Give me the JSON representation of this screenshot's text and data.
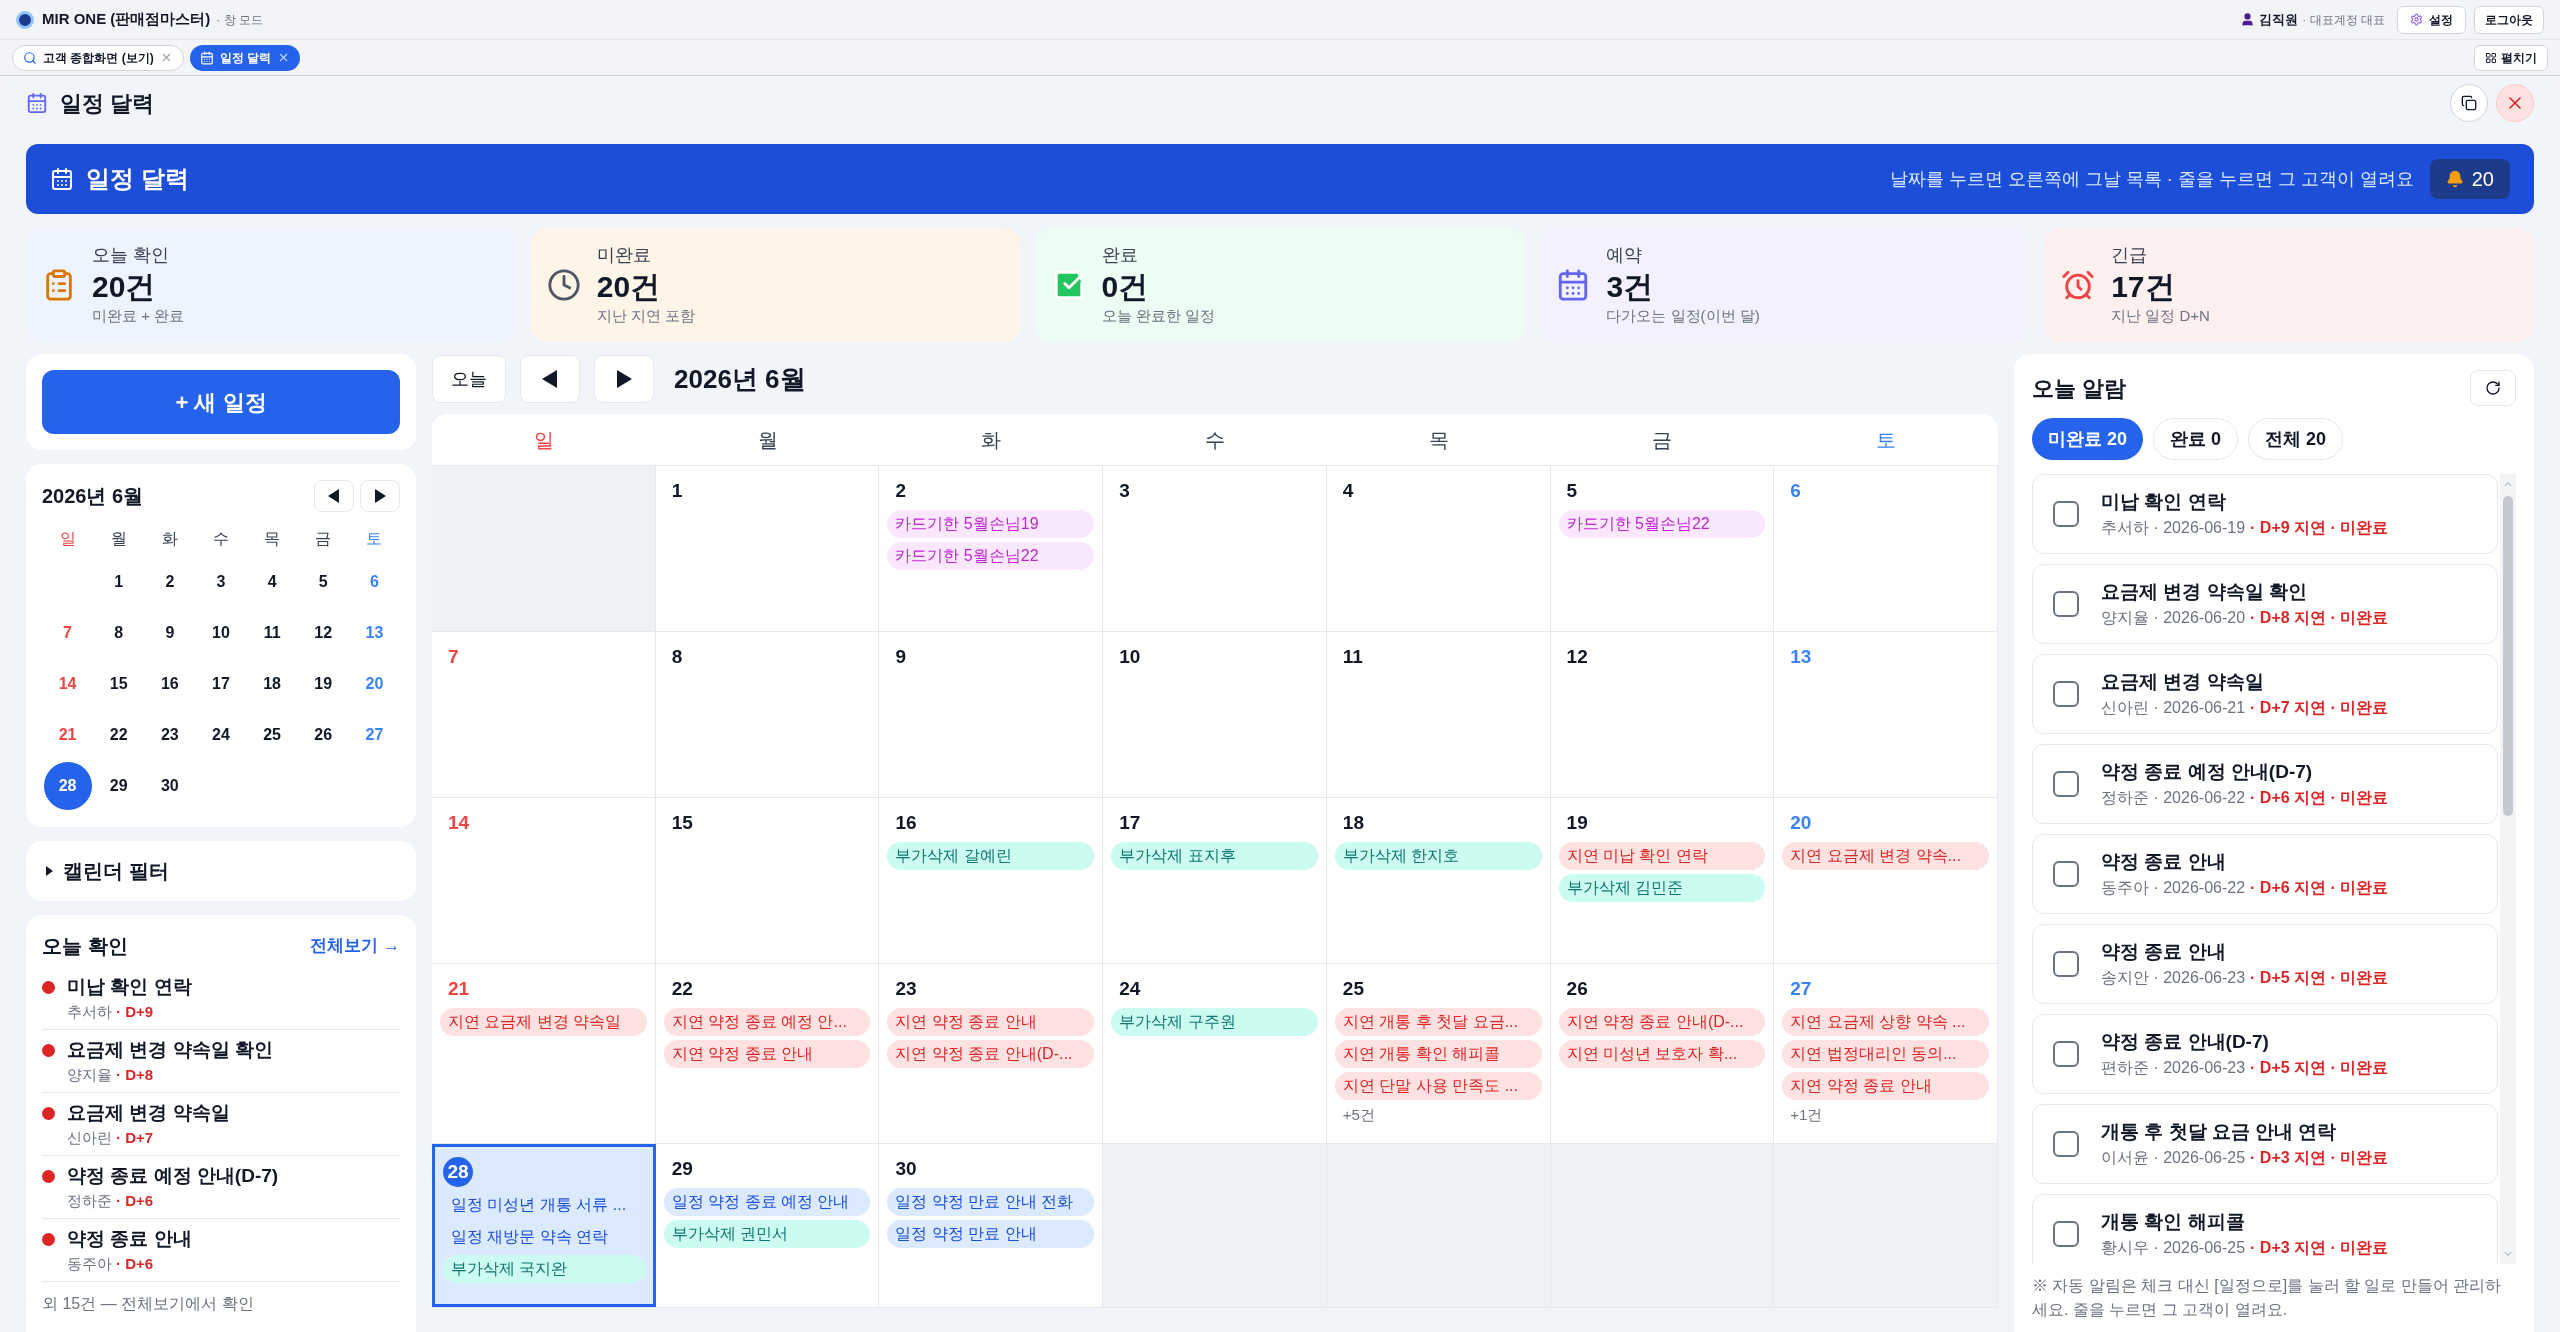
{
  "app_bar": {
    "title": "MIR ONE (판매점마스터)",
    "mode": "· 창 모드",
    "user": "김직원",
    "role": "· 대표계정 대표",
    "settings": "설정",
    "logout": "로그아웃"
  },
  "tabs": [
    {
      "label": "고객 종합화면 (보기)",
      "kind": "search",
      "selected": false
    },
    {
      "label": "일정 달력",
      "kind": "calendar",
      "selected": true
    }
  ],
  "expand_button": "펼치기",
  "window": {
    "title": "일정 달력"
  },
  "banner": {
    "title": "일정 달력",
    "hint": "날짜를 누르면 오른쪽에 그날 목록 · 줄을 누르면 그 고객이 열려요",
    "badge": "20"
  },
  "stats": [
    {
      "kind": "clipboard",
      "label": "오늘 확인",
      "value": "20건",
      "sub": "미완료 + 완료"
    },
    {
      "kind": "clock",
      "label": "미완료",
      "value": "20건",
      "sub": "지난 지연 포함"
    },
    {
      "kind": "check",
      "label": "완료",
      "value": "0건",
      "sub": "오늘 완료한 일정"
    },
    {
      "kind": "calendar",
      "label": "예약",
      "value": "3건",
      "sub": "다가오는 일정(이번 달)"
    },
    {
      "kind": "alarm",
      "label": "긴급",
      "value": "17건",
      "sub": "지난 일정 D+N"
    }
  ],
  "new_event_button": "+ 새 일정",
  "mini_calendar": {
    "title": "2026년 6월",
    "weekdays": [
      "일",
      "월",
      "화",
      "수",
      "목",
      "금",
      "토"
    ],
    "weeks": [
      [
        {
          "day": "1",
          "selected": false
        },
        {
          "day": "2",
          "selected": false
        },
        {
          "day": "3",
          "selected": false
        },
        {
          "day": "4",
          "selected": false
        },
        {
          "day": "5",
          "selected": false
        },
        {
          "day": "6",
          "selected": false
        }
      ],
      [
        {
          "day": "7",
          "selected": false
        },
        {
          "day": "8",
          "selected": false
        },
        {
          "day": "9",
          "selected": false
        },
        {
          "day": "10",
          "selected": false
        },
        {
          "day": "11",
          "selected": false
        },
        {
          "day": "12",
          "selected": false
        },
        {
          "day": "13",
          "selected": false
        }
      ],
      [
        {
          "day": "14",
          "selected": false
        },
        {
          "day": "15",
          "selected": false
        },
        {
          "day": "16",
          "selected": false
        },
        {
          "day": "17",
          "selected": false
        },
        {
          "day": "18",
          "selected": false
        },
        {
          "day": "19",
          "selected": false
        },
        {
          "day": "20",
          "selected": false
        }
      ],
      [
        {
          "day": "21",
          "selected": false
        },
        {
          "day": "22",
          "selected": false
        },
        {
          "day": "23",
          "selected": false
        },
        {
          "day": "24",
          "selected": false
        },
        {
          "day": "25",
          "selected": false
        },
        {
          "day": "26",
          "selected": false
        },
        {
          "day": "27",
          "selected": false
        }
      ],
      [
        {
          "day": "28",
          "selected": true
        },
        {
          "day": "29",
          "selected": false
        },
        {
          "day": "30",
          "selected": false
        }
      ]
    ]
  },
  "filter": {
    "label": "캘린더 필터",
    "expanded": false
  },
  "today_check": {
    "title": "오늘 확인",
    "link": "전체보기 →",
    "items": [
      {
        "title": "미납 확인 연락",
        "name": "추서하",
        "dday": "· D+9"
      },
      {
        "title": "요금제 변경 약속일 확인",
        "name": "양지율",
        "dday": "· D+8"
      },
      {
        "title": "요금제 변경 약속일",
        "name": "신아린",
        "dday": "· D+7"
      },
      {
        "title": "약정 종료 예정 안내(D-7)",
        "name": "정하준",
        "dday": "· D+6"
      },
      {
        "title": "약정 종료 안내",
        "name": "동주아",
        "dday": "· D+6"
      }
    ],
    "more": "외 15건 — 전체보기에서 확인"
  },
  "calendar": {
    "today_button": "오늘",
    "title": "2026년 6월",
    "weekdays": [
      "일",
      "월",
      "화",
      "수",
      "목",
      "금",
      "토"
    ],
    "weeks": [
      [
        {
          "outside": true
        },
        {
          "day": "1",
          "selected": false
        },
        {
          "day": "2",
          "selected": false,
          "events": [
            {
              "kind": "card",
              "label": "카드기한 5월손님19"
            },
            {
              "kind": "card",
              "label": "카드기한 5월손님22"
            }
          ]
        },
        {
          "day": "3",
          "selected": false
        },
        {
          "day": "4",
          "selected": false
        },
        {
          "day": "5",
          "selected": false,
          "events": [
            {
              "kind": "card",
              "label": "카드기한 5월손님22"
            }
          ]
        },
        {
          "day": "6",
          "selected": false
        }
      ],
      [
        {
          "day": "7",
          "selected": false
        },
        {
          "day": "8",
          "selected": false
        },
        {
          "day": "9",
          "selected": false
        },
        {
          "day": "10",
          "selected": false
        },
        {
          "day": "11",
          "selected": false
        },
        {
          "day": "12",
          "selected": false
        },
        {
          "day": "13",
          "selected": false
        }
      ],
      [
        {
          "day": "14",
          "selected": false
        },
        {
          "day": "15",
          "selected": false
        },
        {
          "day": "16",
          "selected": false,
          "events": [
            {
              "kind": "addon",
              "label": "부가삭제 갈예린"
            }
          ]
        },
        {
          "day": "17",
          "selected": false,
          "events": [
            {
              "kind": "addon",
              "label": "부가삭제 표지후"
            }
          ]
        },
        {
          "day": "18",
          "selected": false,
          "events": [
            {
              "kind": "addon",
              "label": "부가삭제 한지호"
            }
          ]
        },
        {
          "day": "19",
          "selected": false,
          "events": [
            {
              "kind": "delay",
              "label": "지연 미납 확인 연락"
            },
            {
              "kind": "addon",
              "label": "부가삭제 김민준"
            }
          ]
        },
        {
          "day": "20",
          "selected": false,
          "events": [
            {
              "kind": "delay",
              "label": "지연 요금제 변경 약속..."
            }
          ]
        }
      ],
      [
        {
          "day": "21",
          "selected": false,
          "events": [
            {
              "kind": "delay",
              "label": "지연 요금제 변경 약속일"
            }
          ]
        },
        {
          "day": "22",
          "selected": false,
          "events": [
            {
              "kind": "delay",
              "label": "지연 약정 종료 예정 안..."
            },
            {
              "kind": "delay",
              "label": "지연 약정 종료 안내"
            }
          ]
        },
        {
          "day": "23",
          "selected": false,
          "events": [
            {
              "kind": "delay",
              "label": "지연 약정 종료 안내"
            },
            {
              "kind": "delay",
              "label": "지연 약정 종료 안내(D-..."
            }
          ]
        },
        {
          "day": "24",
          "selected": false,
          "events": [
            {
              "kind": "addon",
              "label": "부가삭제 구주원"
            }
          ]
        },
        {
          "day": "25",
          "selected": false,
          "events": [
            {
              "kind": "delay",
              "label": "지연 개통 후 첫달 요금..."
            },
            {
              "kind": "delay",
              "label": "지연 개통 확인 해피콜"
            },
            {
              "kind": "delay",
              "label": "지연 단말 사용 만족도 ..."
            }
          ],
          "more": "+5건"
        },
        {
          "day": "26",
          "selected": false,
          "events": [
            {
              "kind": "delay",
              "label": "지연 약정 종료 안내(D-..."
            },
            {
              "kind": "delay",
              "label": "지연 미성년 보호자 확..."
            }
          ]
        },
        {
          "day": "27",
          "selected": false,
          "events": [
            {
              "kind": "delay",
              "label": "지연 요금제 상향 약속 ..."
            },
            {
              "kind": "delay",
              "label": "지연 법정대리인 동의..."
            },
            {
              "kind": "delay",
              "label": "지연 약정 종료 안내"
            }
          ],
          "more": "+1건"
        }
      ],
      [
        {
          "day": "28",
          "selected": true,
          "events": [
            {
              "kind": "schedule",
              "label": "일정 미성년 개통 서류 ..."
            },
            {
              "kind": "schedule",
              "label": "일정 재방문 약속 연락"
            },
            {
              "kind": "addon",
              "label": "부가삭제 국지완"
            }
          ]
        },
        {
          "day": "29",
          "selected": false,
          "events": [
            {
              "kind": "schedule",
              "label": "일정 약정 종료 예정 안내"
            },
            {
              "kind": "addon",
              "label": "부가삭제 권민서"
            }
          ]
        },
        {
          "day": "30",
          "selected": false,
          "events": [
            {
              "kind": "schedule",
              "label": "일정 약정 만료 안내 전화"
            },
            {
              "kind": "schedule",
              "label": "일정 약정 만료 안내"
            }
          ]
        },
        {
          "outside": true
        },
        {
          "outside": true
        },
        {
          "outside": true
        },
        {
          "outside": true
        }
      ]
    ]
  },
  "alarms": {
    "title": "오늘 알람",
    "tabs": [
      {
        "label": "미완료 20",
        "selected": true
      },
      {
        "label": "완료 0",
        "selected": false
      },
      {
        "label": "전체 20",
        "selected": false
      }
    ],
    "items": [
      {
        "title": "미납 확인 연락",
        "meta": "추서하 · 2026-06-19",
        "status": "· D+9 지연 · 미완료",
        "checked": false
      },
      {
        "title": "요금제 변경 약속일 확인",
        "meta": "양지율 · 2026-06-20",
        "status": "· D+8 지연 · 미완료",
        "checked": false
      },
      {
        "title": "요금제 변경 약속일",
        "meta": "신아린 · 2026-06-21",
        "status": "· D+7 지연 · 미완료",
        "checked": false
      },
      {
        "title": "약정 종료 예정 안내(D-7)",
        "meta": "정하준 · 2026-06-22",
        "status": "· D+6 지연 · 미완료",
        "checked": false
      },
      {
        "title": "약정 종료 안내",
        "meta": "동주아 · 2026-06-22",
        "status": "· D+6 지연 · 미완료",
        "checked": false
      },
      {
        "title": "약정 종료 안내",
        "meta": "송지안 · 2026-06-23",
        "status": "· D+5 지연 · 미완료",
        "checked": false
      },
      {
        "title": "약정 종료 안내(D-7)",
        "meta": "편하준 · 2026-06-23",
        "status": "· D+5 지연 · 미완료",
        "checked": false
      },
      {
        "title": "개통 후 첫달 요금 안내 연락",
        "meta": "이서윤 · 2026-06-25",
        "status": "· D+3 지연 · 미완료",
        "checked": false
      },
      {
        "title": "개통 확인 해피콜",
        "meta": "황시우 · 2026-06-25",
        "status": "· D+3 지연 · 미완료",
        "checked": false
      }
    ],
    "note": "※ 자동 알림은 체크 대신 [일정으로]를 눌러 할 일로 만들어 관리하세요. 줄을 누르면 그 고객이 열려요."
  }
}
